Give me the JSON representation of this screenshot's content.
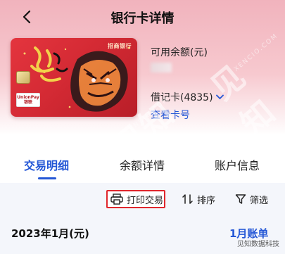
{
  "header": {
    "title": "银行卡详情",
    "back_icon": "chevron-left-icon"
  },
  "card": {
    "bank_short": "招商银行",
    "unionpay_top": "UnionPay",
    "unionpay_bottom": "银联",
    "accent": "#d42a34"
  },
  "account": {
    "balance_label": "可用余额(元)",
    "card_type": "借记卡(4835)",
    "view_card_no": "查看卡号"
  },
  "tabs": [
    {
      "label": "交易明细",
      "active": true
    },
    {
      "label": "余额详情",
      "active": false
    },
    {
      "label": "账户信息",
      "active": false
    }
  ],
  "actions": {
    "print": "打印交易",
    "sort": "排序",
    "filter": "筛选"
  },
  "month": {
    "label": "2023年1月(元)",
    "bill": "1月账单"
  },
  "watermark": {
    "text": "见知",
    "sub": "XENCIO.COM",
    "caption": "见知数据科技"
  },
  "colors": {
    "primary": "#2457d6",
    "highlight_border": "#e0272d"
  }
}
